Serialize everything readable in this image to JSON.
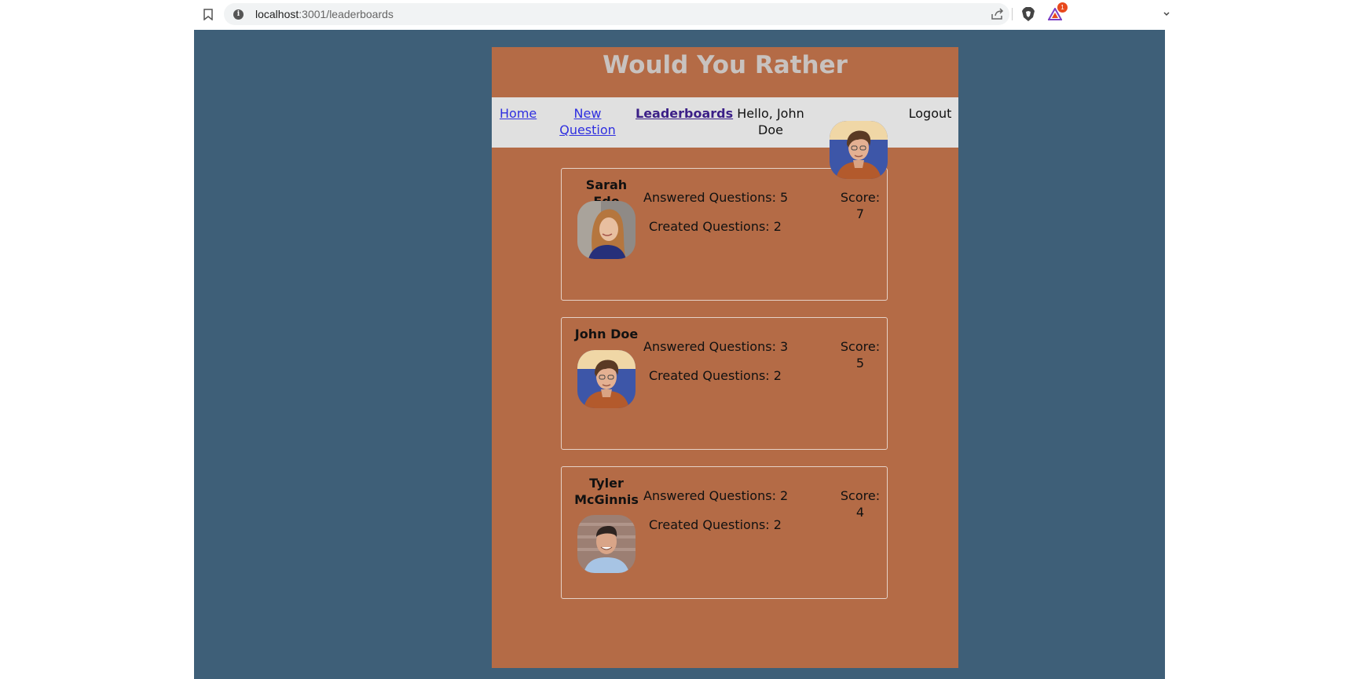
{
  "browser": {
    "url_host": "localhost",
    "url_path": ":3001/leaderboards",
    "notification_count": "1",
    "icons": [
      "bookmark-icon",
      "site-info-icon",
      "share-icon",
      "brave-shield-icon",
      "brave-rewards-icon",
      "menu-chevron-icon"
    ]
  },
  "app": {
    "title": "Would You Rather",
    "colors": {
      "page_background": "#3e5f78",
      "app_background": "#b46b46",
      "nav_background": "#e0e0e0",
      "title": "#c8c2bf",
      "link": "#2f2fe0",
      "active_link": "#3b1f87"
    }
  },
  "nav": {
    "home": "Home",
    "new_question_line1": "New",
    "new_question_line2": "Question",
    "leaderboards": "Leaderboards",
    "greeting_line1": "Hello, John",
    "greeting_line2": "Doe",
    "logout": "Logout"
  },
  "leaderboard": [
    {
      "name_line1": "Sarah Edo",
      "name_line2": "",
      "answered": "Answered Questions: 5",
      "created": "Created Questions: 2",
      "score_label": "Score:",
      "score": "7"
    },
    {
      "name_line1": "John Doe",
      "name_line2": "",
      "answered": "Answered Questions: 3",
      "created": "Created Questions: 2",
      "score_label": "Score:",
      "score": "5"
    },
    {
      "name_line1": "Tyler",
      "name_line2": "McGinnis",
      "answered": "Answered Questions: 2",
      "created": "Created Questions: 2",
      "score_label": "Score:",
      "score": "4"
    }
  ]
}
